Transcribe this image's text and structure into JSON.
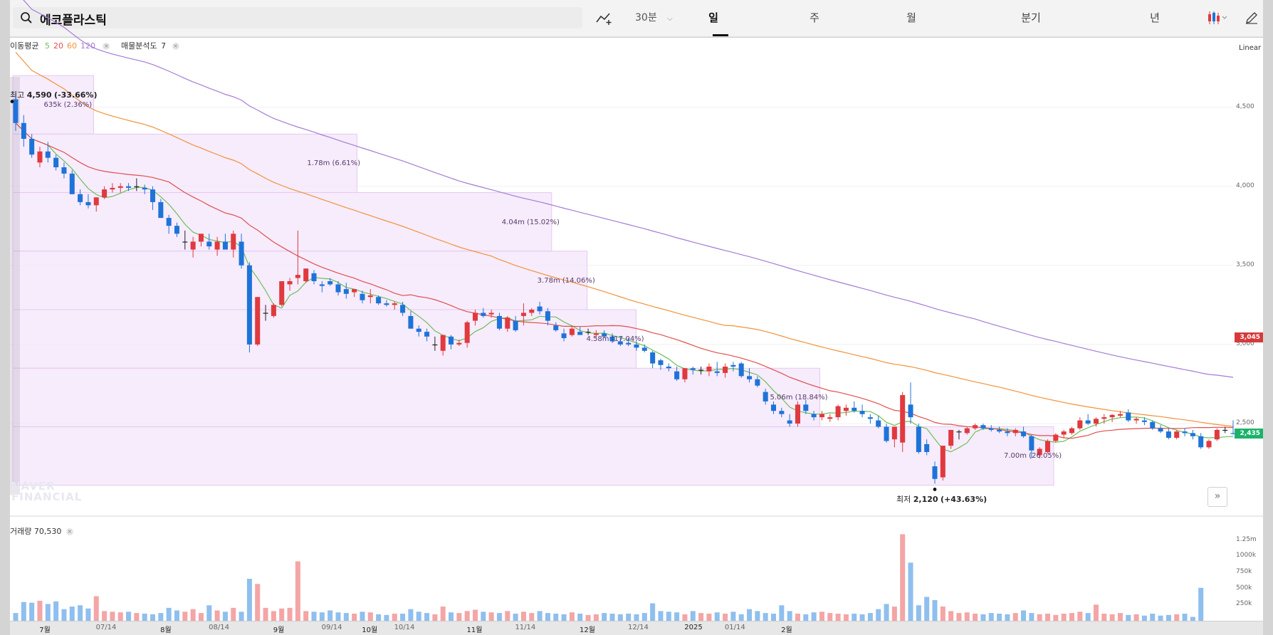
{
  "search": {
    "value": "에코플라스틱",
    "icon": "search-icon"
  },
  "toolbar": {
    "indicator_icon": "chart-indicator-add-icon",
    "interval": "30분",
    "tabs": [
      "일",
      "주",
      "월",
      "분기",
      "년"
    ],
    "active_tab": "일",
    "chart_type_icon": "candlestick-icon",
    "draw_icon": "pencil-icon"
  },
  "legend": {
    "ma_label": "이동평균",
    "ma_periods": [
      "5",
      "20",
      "60",
      "120"
    ],
    "ma_colors": [
      "#6fbf5a",
      "#e0504e",
      "#f2923a",
      "#a67bd6"
    ],
    "vp_label": "매물분석도",
    "vp_value": "7"
  },
  "scale_mode": "Linear",
  "price_axis": {
    "ticks": [
      "4,500",
      "4,000",
      "3,500",
      "3,000",
      "2,500"
    ],
    "current_close": "2,435",
    "ref_price": "3,045"
  },
  "volume_axis": {
    "ticks": [
      "1.25m",
      "1000k",
      "750k",
      "500k",
      "250k"
    ]
  },
  "high_marker": {
    "prefix": "최고",
    "value": "4,590",
    "change": "(-33.66%)"
  },
  "low_marker": {
    "prefix": "최저",
    "value": "2,120",
    "change": "(+43.63%)"
  },
  "volume_profile": [
    {
      "label": "635k (2.36%)",
      "price_low": 4330,
      "price_high": 4700,
      "width_frac": 0.066
    },
    {
      "label": "1.78m (6.61%)",
      "price_low": 3960,
      "price_high": 4330,
      "width_frac": 0.281
    },
    {
      "label": "4.04m (15.02%)",
      "price_low": 3590,
      "price_high": 3960,
      "width_frac": 0.44
    },
    {
      "label": "3.78m (14.06%)",
      "price_low": 3220,
      "price_high": 3590,
      "width_frac": 0.469
    },
    {
      "label": "4.58m (17.04%)",
      "price_low": 2850,
      "price_high": 3220,
      "width_frac": 0.509
    },
    {
      "label": "5.06m (18.84%)",
      "price_low": 2480,
      "price_high": 2850,
      "width_frac": 0.659
    },
    {
      "label": "7.00m (26.05%)",
      "price_low": 2110,
      "price_high": 2480,
      "width_frac": 0.85
    }
  ],
  "volume_legend": {
    "label": "거래량",
    "value": "70,530"
  },
  "x_labels": [
    {
      "text": "7월",
      "idx": 4,
      "major": true
    },
    {
      "text": "07/14",
      "idx": 11,
      "major": false
    },
    {
      "text": "8월",
      "idx": 19,
      "major": true
    },
    {
      "text": "08/14",
      "idx": 25,
      "major": false
    },
    {
      "text": "9월",
      "idx": 33,
      "major": true
    },
    {
      "text": "09/14",
      "idx": 39,
      "major": false
    },
    {
      "text": "10월",
      "idx": 44,
      "major": true
    },
    {
      "text": "10/14",
      "idx": 48,
      "major": false
    },
    {
      "text": "11월",
      "idx": 57,
      "major": true
    },
    {
      "text": "11/14",
      "idx": 63,
      "major": false
    },
    {
      "text": "12월",
      "idx": 71,
      "major": true
    },
    {
      "text": "12/14",
      "idx": 77,
      "major": false
    },
    {
      "text": "2025",
      "idx": 84,
      "major": true
    },
    {
      "text": "01/14",
      "idx": 89,
      "major": false
    },
    {
      "text": "2월",
      "idx": 96,
      "major": true
    }
  ],
  "watermark": [
    "NAVER",
    "FINANCIAL"
  ],
  "chart_data": {
    "type": "candlestick",
    "y_range": [
      2050,
      4750
    ],
    "volume_max": 1400000,
    "ohlc": [
      [
        4550,
        4590,
        4350,
        4400
      ],
      [
        4400,
        4450,
        4250,
        4300
      ],
      [
        4300,
        4330,
        4180,
        4200
      ],
      [
        4150,
        4250,
        4120,
        4220
      ],
      [
        4220,
        4280,
        4150,
        4180
      ],
      [
        4180,
        4200,
        4100,
        4120
      ],
      [
        4120,
        4150,
        4050,
        4080
      ],
      [
        4080,
        4100,
        3950,
        3950
      ],
      [
        3950,
        3980,
        3880,
        3900
      ],
      [
        3900,
        3950,
        3860,
        3880
      ],
      [
        3880,
        3930,
        3840,
        3930
      ],
      [
        3930,
        4000,
        3920,
        3980
      ],
      [
        3980,
        4020,
        3960,
        3990
      ],
      [
        3990,
        4020,
        3960,
        4000
      ],
      [
        4000,
        4020,
        3970,
        3990
      ],
      [
        4000,
        4050,
        3970,
        4000
      ],
      [
        3990,
        4010,
        3950,
        3980
      ],
      [
        3980,
        4000,
        3850,
        3900
      ],
      [
        3900,
        3920,
        3800,
        3800
      ],
      [
        3800,
        3820,
        3700,
        3750
      ],
      [
        3750,
        3770,
        3680,
        3700
      ],
      [
        3650,
        3720,
        3600,
        3650
      ],
      [
        3600,
        3680,
        3550,
        3650
      ],
      [
        3650,
        3700,
        3620,
        3700
      ],
      [
        3650,
        3700,
        3600,
        3620
      ],
      [
        3600,
        3680,
        3560,
        3650
      ],
      [
        3650,
        3700,
        3600,
        3600
      ],
      [
        3600,
        3720,
        3550,
        3700
      ],
      [
        3650,
        3700,
        3480,
        3500
      ],
      [
        3500,
        3520,
        2950,
        3000
      ],
      [
        3000,
        3300,
        2990,
        3300
      ],
      [
        3200,
        3250,
        3150,
        3200
      ],
      [
        3180,
        3260,
        3170,
        3250
      ],
      [
        3250,
        3400,
        3240,
        3400
      ],
      [
        3380,
        3420,
        3340,
        3400
      ],
      [
        3420,
        3720,
        3380,
        3440
      ],
      [
        3400,
        3480,
        3390,
        3480
      ],
      [
        3450,
        3470,
        3380,
        3400
      ],
      [
        3380,
        3400,
        3330,
        3370
      ],
      [
        3400,
        3420,
        3370,
        3380
      ],
      [
        3380,
        3400,
        3310,
        3330
      ],
      [
        3350,
        3390,
        3290,
        3320
      ],
      [
        3330,
        3350,
        3300,
        3350
      ],
      [
        3320,
        3340,
        3260,
        3280
      ],
      [
        3300,
        3350,
        3260,
        3310
      ],
      [
        3300,
        3310,
        3250,
        3260
      ],
      [
        3260,
        3280,
        3240,
        3250
      ],
      [
        3250,
        3270,
        3220,
        3260
      ],
      [
        3250,
        3270,
        3180,
        3200
      ],
      [
        3180,
        3210,
        3100,
        3100
      ],
      [
        3100,
        3120,
        3050,
        3080
      ],
      [
        3080,
        3100,
        3020,
        3050
      ],
      [
        3000,
        3050,
        2960,
        3000
      ],
      [
        2960,
        3060,
        2930,
        3060
      ],
      [
        3050,
        3060,
        2970,
        3000
      ],
      [
        3000,
        3030,
        2990,
        3010
      ],
      [
        3010,
        3150,
        2980,
        3140
      ],
      [
        3150,
        3220,
        3120,
        3200
      ],
      [
        3200,
        3230,
        3170,
        3180
      ],
      [
        3190,
        3220,
        3170,
        3200
      ],
      [
        3180,
        3200,
        3090,
        3100
      ],
      [
        3100,
        3180,
        3080,
        3170
      ],
      [
        3150,
        3180,
        3080,
        3090
      ],
      [
        3180,
        3260,
        3120,
        3200
      ],
      [
        3200,
        3230,
        3180,
        3220
      ],
      [
        3240,
        3270,
        3190,
        3210
      ],
      [
        3210,
        3230,
        3120,
        3150
      ],
      [
        3120,
        3140,
        3080,
        3090
      ],
      [
        3070,
        3100,
        3020,
        3040
      ],
      [
        3060,
        3120,
        3050,
        3100
      ],
      [
        3080,
        3110,
        3060,
        3060
      ],
      [
        3080,
        3100,
        3060,
        3080
      ],
      [
        3060,
        3090,
        3040,
        3070
      ],
      [
        3070,
        3090,
        3040,
        3050
      ],
      [
        3050,
        3070,
        3010,
        3020
      ],
      [
        3020,
        3050,
        2990,
        3000
      ],
      [
        3010,
        3040,
        2990,
        3000
      ],
      [
        3000,
        3020,
        2960,
        2980
      ],
      [
        2980,
        3000,
        2950,
        2960
      ],
      [
        2950,
        2960,
        2850,
        2880
      ],
      [
        2900,
        2910,
        2840,
        2870
      ],
      [
        2860,
        2880,
        2830,
        2850
      ],
      [
        2830,
        2860,
        2770,
        2780
      ],
      [
        2780,
        2850,
        2760,
        2850
      ],
      [
        2850,
        2860,
        2810,
        2840
      ],
      [
        2840,
        2860,
        2810,
        2840
      ],
      [
        2830,
        2880,
        2800,
        2860
      ],
      [
        2830,
        2890,
        2800,
        2820
      ],
      [
        2820,
        2880,
        2790,
        2860
      ],
      [
        2870,
        2890,
        2830,
        2860
      ],
      [
        2880,
        2890,
        2790,
        2800
      ],
      [
        2800,
        2850,
        2760,
        2780
      ],
      [
        2780,
        2800,
        2730,
        2740
      ],
      [
        2700,
        2720,
        2620,
        2640
      ],
      [
        2620,
        2640,
        2560,
        2580
      ],
      [
        2580,
        2600,
        2540,
        2560
      ],
      [
        2520,
        2560,
        2480,
        2500
      ],
      [
        2500,
        2640,
        2480,
        2620
      ],
      [
        2620,
        2650,
        2560,
        2580
      ],
      [
        2560,
        2580,
        2520,
        2540
      ],
      [
        2540,
        2580,
        2520,
        2560
      ],
      [
        2530,
        2560,
        2510,
        2540
      ],
      [
        2540,
        2620,
        2520,
        2610
      ],
      [
        2580,
        2620,
        2550,
        2600
      ],
      [
        2600,
        2640,
        2570,
        2580
      ],
      [
        2580,
        2620,
        2540,
        2560
      ],
      [
        2540,
        2560,
        2500,
        2530
      ],
      [
        2520,
        2550,
        2470,
        2480
      ],
      [
        2480,
        2500,
        2380,
        2390
      ],
      [
        2400,
        2420,
        2350,
        2480
      ],
      [
        2380,
        2700,
        2320,
        2680
      ],
      [
        2620,
        2760,
        2500,
        2540
      ],
      [
        2480,
        2500,
        2310,
        2320
      ],
      [
        2370,
        2400,
        2300,
        2320
      ],
      [
        2230,
        2260,
        2120,
        2150
      ],
      [
        2160,
        2360,
        2140,
        2360
      ],
      [
        2360,
        2460,
        2340,
        2460
      ],
      [
        2450,
        2460,
        2400,
        2450
      ],
      [
        2440,
        2480,
        2430,
        2470
      ],
      [
        2470,
        2500,
        2460,
        2490
      ],
      [
        2490,
        2500,
        2460,
        2470
      ],
      [
        2470,
        2490,
        2450,
        2460
      ],
      [
        2460,
        2480,
        2440,
        2450
      ],
      [
        2450,
        2470,
        2420,
        2440
      ],
      [
        2440,
        2470,
        2420,
        2460
      ],
      [
        2450,
        2480,
        2410,
        2420
      ],
      [
        2420,
        2430,
        2280,
        2330
      ],
      [
        2300,
        2350,
        2280,
        2340
      ],
      [
        2320,
        2400,
        2310,
        2390
      ],
      [
        2390,
        2440,
        2380,
        2430
      ],
      [
        2430,
        2460,
        2410,
        2450
      ],
      [
        2440,
        2480,
        2430,
        2470
      ],
      [
        2470,
        2540,
        2460,
        2520
      ],
      [
        2520,
        2560,
        2490,
        2500
      ],
      [
        2500,
        2540,
        2480,
        2530
      ],
      [
        2530,
        2560,
        2500,
        2540
      ],
      [
        2540,
        2560,
        2510,
        2555
      ],
      [
        2550,
        2580,
        2540,
        2560
      ],
      [
        2570,
        2590,
        2510,
        2520
      ],
      [
        2520,
        2540,
        2500,
        2530
      ],
      [
        2520,
        2540,
        2490,
        2510
      ],
      [
        2510,
        2520,
        2460,
        2470
      ],
      [
        2470,
        2490,
        2440,
        2450
      ],
      [
        2450,
        2470,
        2400,
        2410
      ],
      [
        2410,
        2460,
        2400,
        2450
      ],
      [
        2450,
        2470,
        2420,
        2440
      ],
      [
        2440,
        2460,
        2400,
        2420
      ],
      [
        2420,
        2440,
        2340,
        2350
      ],
      [
        2350,
        2400,
        2340,
        2390
      ],
      [
        2400,
        2470,
        2390,
        2460
      ],
      [
        2460,
        2480,
        2440,
        2460
      ],
      [
        2440,
        2520,
        2430,
        2435
      ]
    ],
    "volume": [
      120000,
      290000,
      280000,
      310000,
      260000,
      300000,
      180000,
      220000,
      240000,
      190000,
      380000,
      150000,
      140000,
      130000,
      140000,
      120000,
      110000,
      100000,
      120000,
      200000,
      160000,
      140000,
      180000,
      120000,
      240000,
      160000,
      140000,
      200000,
      140000,
      650000,
      570000,
      200000,
      150000,
      190000,
      200000,
      920000,
      150000,
      140000,
      130000,
      160000,
      130000,
      120000,
      110000,
      140000,
      130000,
      100000,
      90000,
      110000,
      110000,
      180000,
      140000,
      120000,
      100000,
      220000,
      130000,
      120000,
      150000,
      170000,
      140000,
      130000,
      120000,
      150000,
      110000,
      140000,
      120000,
      150000,
      120000,
      110000,
      100000,
      130000,
      110000,
      90000,
      100000,
      120000,
      110000,
      100000,
      110000,
      100000,
      120000,
      270000,
      150000,
      140000,
      130000,
      100000,
      150000,
      120000,
      110000,
      130000,
      110000,
      140000,
      100000,
      180000,
      150000,
      120000,
      110000,
      240000,
      150000,
      110000,
      100000,
      130000,
      140000,
      120000,
      110000,
      100000,
      110000,
      100000,
      120000,
      180000,
      260000,
      220000,
      1340000,
      900000,
      240000,
      370000,
      320000,
      220000,
      150000,
      120000,
      130000,
      110000,
      100000,
      120000,
      110000,
      100000,
      120000,
      160000,
      120000,
      100000,
      110000,
      90000,
      110000,
      120000,
      140000,
      120000,
      250000,
      110000,
      100000,
      120000,
      90000,
      100000,
      80000,
      110000,
      80000,
      90000,
      100000,
      110000,
      60000,
      510000
    ]
  }
}
